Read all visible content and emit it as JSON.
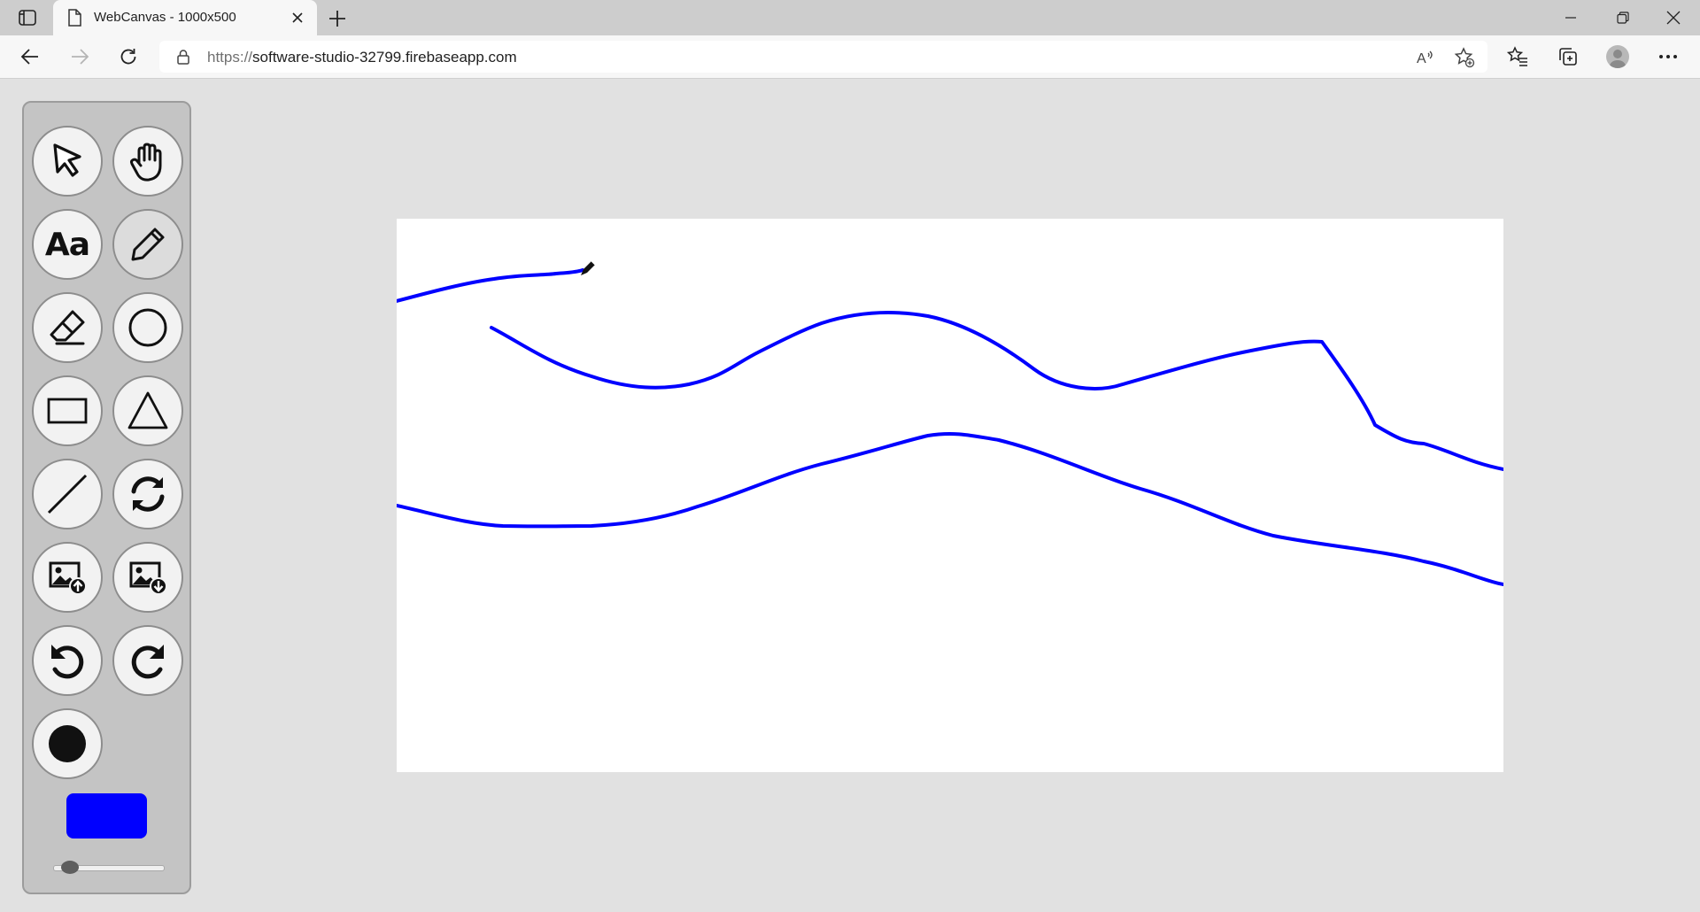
{
  "browser": {
    "tab_title": "WebCanvas - 1000x500",
    "url_prefix": "https://",
    "url_host": "software-studio-32799.firebaseapp.com"
  },
  "tools": [
    {
      "name": "select-tool",
      "icon": "cursor-arrow-icon"
    },
    {
      "name": "hand-tool",
      "icon": "hand-icon"
    },
    {
      "name": "text-tool",
      "icon": "text-icon",
      "label": "Aa"
    },
    {
      "name": "pencil-tool",
      "icon": "pencil-icon",
      "active": true
    },
    {
      "name": "eraser-tool",
      "icon": "eraser-icon"
    },
    {
      "name": "circle-tool",
      "icon": "circle-icon"
    },
    {
      "name": "rectangle-tool",
      "icon": "rectangle-icon"
    },
    {
      "name": "triangle-tool",
      "icon": "triangle-icon"
    },
    {
      "name": "line-tool",
      "icon": "line-icon"
    },
    {
      "name": "refresh-tool",
      "icon": "refresh-icon"
    },
    {
      "name": "upload-image-tool",
      "icon": "image-upload-icon"
    },
    {
      "name": "download-image-tool",
      "icon": "image-download-icon"
    },
    {
      "name": "undo-tool",
      "icon": "undo-icon"
    },
    {
      "name": "redo-tool",
      "icon": "redo-icon"
    },
    {
      "name": "brush-tool",
      "icon": "filled-circle-icon"
    }
  ],
  "brush": {
    "color": "#0000ff",
    "size_fraction": 0.05
  },
  "canvas": {
    "stroke_color": "#0000ff",
    "background": "#ffffff"
  }
}
